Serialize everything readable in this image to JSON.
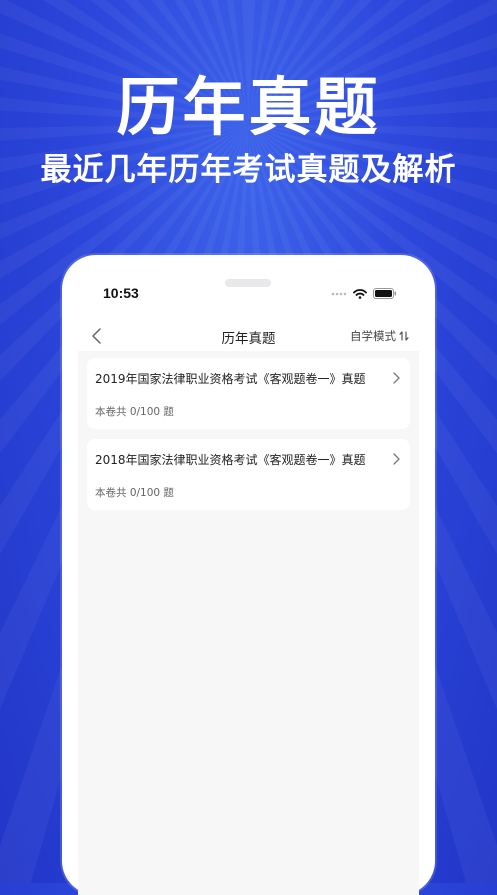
{
  "promo": {
    "headline": "历年真题",
    "subline": "最近几年历年考试真题及解析"
  },
  "status_bar": {
    "time": "10:53"
  },
  "nav": {
    "title": "历年真题",
    "mode_label": "自学模式",
    "back_icon": "chevron-left-icon",
    "mode_icon": "sort-arrows-icon"
  },
  "papers": [
    {
      "title": "2019年国家法律职业资格考试《客观题卷一》真题",
      "progress": "本卷共  0/100  题"
    },
    {
      "title": "2018年国家法律职业资格考试《客观题卷一》真题",
      "progress": "本卷共  0/100  题"
    }
  ],
  "colors": {
    "background": "#2c47dc",
    "text_primary": "#222222",
    "text_secondary": "#666666"
  }
}
